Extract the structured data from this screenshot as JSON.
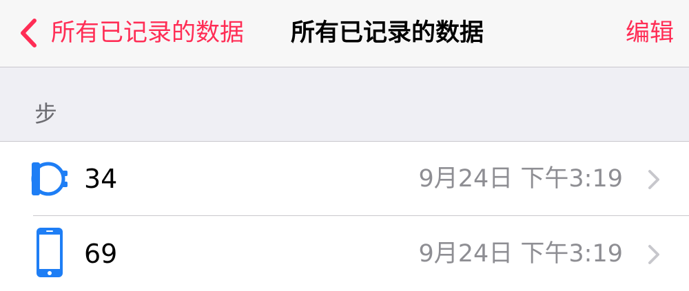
{
  "navbar": {
    "back_label": "所有已记录的数据",
    "title": "所有已记录的数据",
    "edit_label": "编辑"
  },
  "section": {
    "title": "步"
  },
  "rows": [
    {
      "value": "34",
      "time": "9月24日 下午3:19",
      "icon": "apple-watch-icon"
    },
    {
      "value": "69",
      "time": "9月24日 下午3:19",
      "icon": "iphone-icon"
    }
  ],
  "colors": {
    "accent": "#ff2d55",
    "icon_blue": "#1e7ef5",
    "secondary_text": "#8e8e93",
    "nav_background": "#f7f7f7",
    "section_background": "#efeff4"
  }
}
